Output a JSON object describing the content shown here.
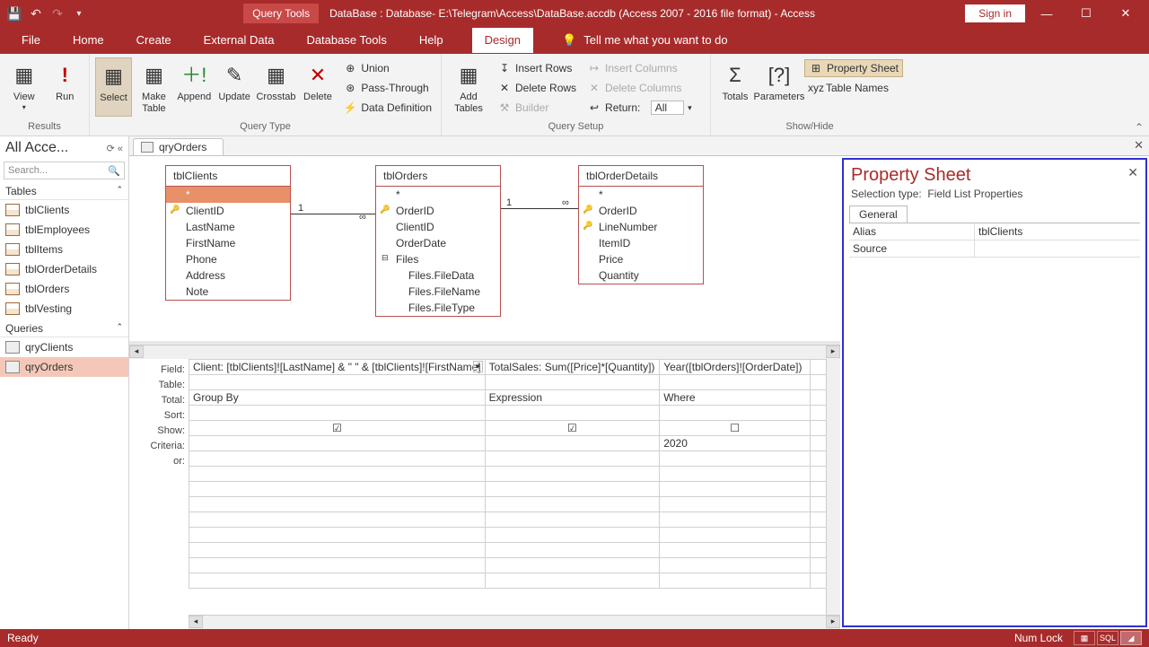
{
  "titlebar": {
    "context_tab": "Query Tools",
    "title": "DataBase : Database- E:\\Telegram\\Access\\DataBase.accdb (Access 2007 - 2016 file format)  -  Access",
    "signin": "Sign in"
  },
  "tabs": {
    "file": "File",
    "home": "Home",
    "create": "Create",
    "external": "External Data",
    "dbtools": "Database Tools",
    "help": "Help",
    "design": "Design",
    "tellme": "Tell me what you want to do"
  },
  "ribbon": {
    "results": "Results",
    "view": "View",
    "run": "Run",
    "querytype": "Query Type",
    "select": "Select",
    "maketable": "Make Table",
    "append": "Append",
    "update": "Update",
    "crosstab": "Crosstab",
    "delete": "Delete",
    "union": "Union",
    "passthrough": "Pass-Through",
    "datadef": "Data Definition",
    "querysetup": "Query Setup",
    "addtables": "Add Tables",
    "insertrows": "Insert Rows",
    "deleterows": "Delete Rows",
    "builder": "Builder",
    "insertcols": "Insert Columns",
    "deletecols": "Delete Columns",
    "return": "Return:",
    "return_val": "All",
    "showhide": "Show/Hide",
    "totals": "Totals",
    "parameters": "Parameters",
    "propsheet": "Property Sheet",
    "tablenames": "Table Names"
  },
  "nav": {
    "header": "All Acce...",
    "search": "Search...",
    "tables_hdr": "Tables",
    "queries_hdr": "Queries",
    "tables": [
      "tblClients",
      "tblEmployees",
      "tblItems",
      "tblOrderDetails",
      "tblOrders",
      "tblVesting"
    ],
    "queries": [
      "qryClients",
      "qryOrders"
    ]
  },
  "doctab": "qryOrders",
  "diagram": {
    "t1": {
      "name": "tblClients",
      "fields": [
        "*",
        "ClientID",
        "LastName",
        "FirstName",
        "Phone",
        "Address",
        "Note"
      ]
    },
    "t2": {
      "name": "tblOrders",
      "fields": [
        "*",
        "OrderID",
        "ClientID",
        "OrderDate",
        "Files",
        "Files.FileData",
        "Files.FileName",
        "Files.FileType"
      ]
    },
    "t3": {
      "name": "tblOrderDetails",
      "fields": [
        "*",
        "OrderID",
        "LineNumber",
        "ItemID",
        "Price",
        "Quantity"
      ]
    },
    "rel": {
      "one": "1",
      "many": "∞"
    }
  },
  "grid": {
    "labels": [
      "Field:",
      "Table:",
      "Total:",
      "Sort:",
      "Show:",
      "Criteria:",
      "or:"
    ],
    "cols": [
      {
        "field": "Client: [tblClients]![LastName] & \" \" & [tblClients]![FirstName]",
        "total": "Group By",
        "show": true,
        "criteria": ""
      },
      {
        "field": "TotalSales: Sum([Price]*[Quantity])",
        "total": "Expression",
        "show": true,
        "criteria": ""
      },
      {
        "field": "Year([tblOrders]![OrderDate])",
        "total": "Where",
        "show": false,
        "criteria": "2020"
      }
    ]
  },
  "prop": {
    "title": "Property Sheet",
    "subtype_label": "Selection type:",
    "subtype": "Field List Properties",
    "tab": "General",
    "rows": [
      {
        "k": "Alias",
        "v": "tblClients"
      },
      {
        "k": "Source",
        "v": ""
      }
    ]
  },
  "status": {
    "ready": "Ready",
    "numlock": "Num Lock",
    "sql": "SQL"
  }
}
